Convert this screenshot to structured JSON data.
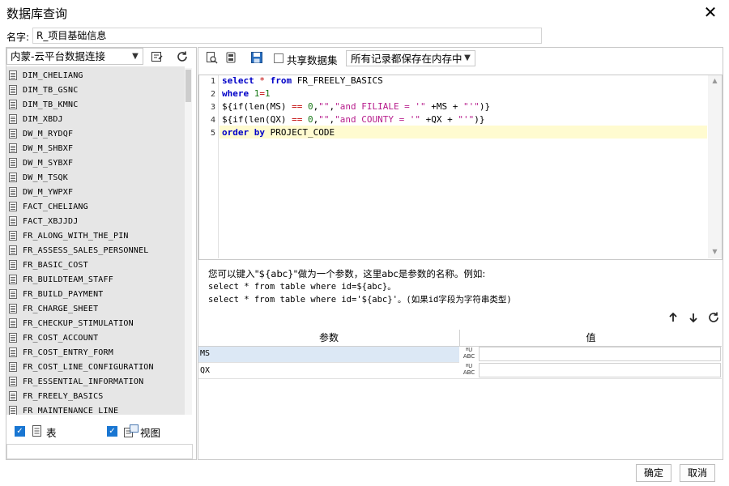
{
  "window": {
    "title": "数据库查询"
  },
  "name_row": {
    "label": "名字:",
    "value": "R_项目基础信息"
  },
  "left": {
    "connection": "内蒙-云平台数据连接",
    "tables": [
      "DIM_CHELIANG",
      "DIM_TB_GSNC",
      "DIM_TB_KMNC",
      "DIM_XBDJ",
      "DW_M_RYDQF",
      "DW_M_SHBXF",
      "DW_M_SYBXF",
      "DW_M_TSQK",
      "DW_M_YWPXF",
      "FACT_CHELIANG",
      "FACT_XBJJDJ",
      "FR_ALONG_WITH_THE_PIN",
      "FR_ASSESS_SALES_PERSONNEL",
      "FR_BASIC_COST",
      "FR_BUILDTEAM_STAFF",
      "FR_BUILD_PAYMENT",
      "FR_CHARGE_SHEET",
      "FR_CHECKUP_STIMULATION",
      "FR_COST_ACCOUNT",
      "FR_COST_ENTRY_FORM",
      "FR_COST_LINE_CONFIGURATION",
      "FR_ESSENTIAL_INFORMATION",
      "FR_FREELY_BASICS",
      "FR_MAINTENANCE_LINE"
    ],
    "filter_table_label": "表",
    "filter_view_label": "视图"
  },
  "toolbar": {
    "share_label": "共享数据集",
    "memory_option": "所有记录都保存在内存中"
  },
  "editor": {
    "line_numbers": [
      "1",
      "2",
      "3",
      "4",
      "5"
    ]
  },
  "hint": {
    "line1": "您可以键入\"${abc}\"做为一个参数，这里abc是参数的名称。例如:",
    "line2": "select * from table where id=${abc}。",
    "line3": "select * from table where id='${abc}'。(如果id字段为字符串类型)"
  },
  "params": {
    "col_name": "参数",
    "col_value": "值",
    "rows": [
      {
        "name": "MS",
        "type": "ABC",
        "value": ""
      },
      {
        "name": "QX",
        "type": "ABC",
        "value": ""
      }
    ]
  },
  "buttons": {
    "ok": "确定",
    "cancel": "取消"
  }
}
